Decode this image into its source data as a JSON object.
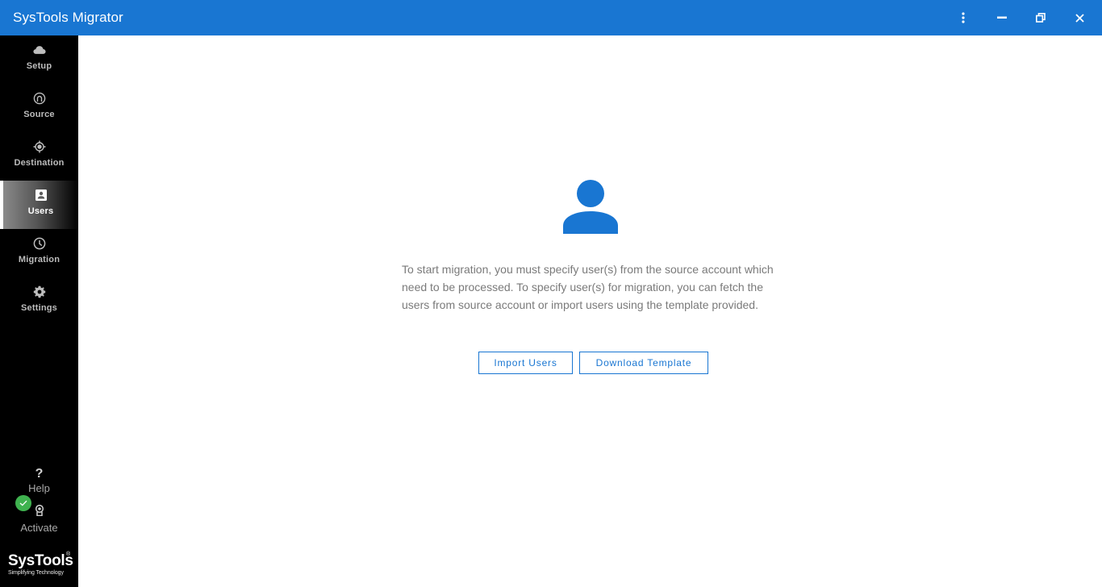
{
  "app": {
    "title": "SysTools Migrator"
  },
  "window_controls": {
    "menu_icon": "more-vertical-icon",
    "minimize_icon": "minimize-icon",
    "restore_icon": "restore-icon",
    "close_icon": "close-icon"
  },
  "sidebar": {
    "items": [
      {
        "label": "Setup",
        "icon": "cloud-icon",
        "active": false
      },
      {
        "label": "Source",
        "icon": "source-icon",
        "active": false
      },
      {
        "label": "Destination",
        "icon": "target-icon",
        "active": false
      },
      {
        "label": "Users",
        "icon": "user-badge-icon",
        "active": true
      },
      {
        "label": "Migration",
        "icon": "clock-icon",
        "active": false
      },
      {
        "label": "Settings",
        "icon": "gear-icon",
        "active": false
      }
    ],
    "help": {
      "label": "Help",
      "glyph": "?"
    },
    "activate": {
      "label": "Activate",
      "status": "activated"
    },
    "logo": {
      "brand": "SysTools",
      "registered": "®",
      "tagline": "Simplifying Technology"
    }
  },
  "main": {
    "description": "To start migration, you must specify user(s) from the source account which need to be processed. To specify user(s) for migration, you can fetch the users from source account or import users using the template provided.",
    "buttons": {
      "import": "Import Users",
      "download": "Download Template"
    }
  },
  "colors": {
    "accent": "#1976d2",
    "sidebar_bg": "#000000",
    "success": "#3fb24f",
    "text_muted": "#7a7a7a"
  }
}
